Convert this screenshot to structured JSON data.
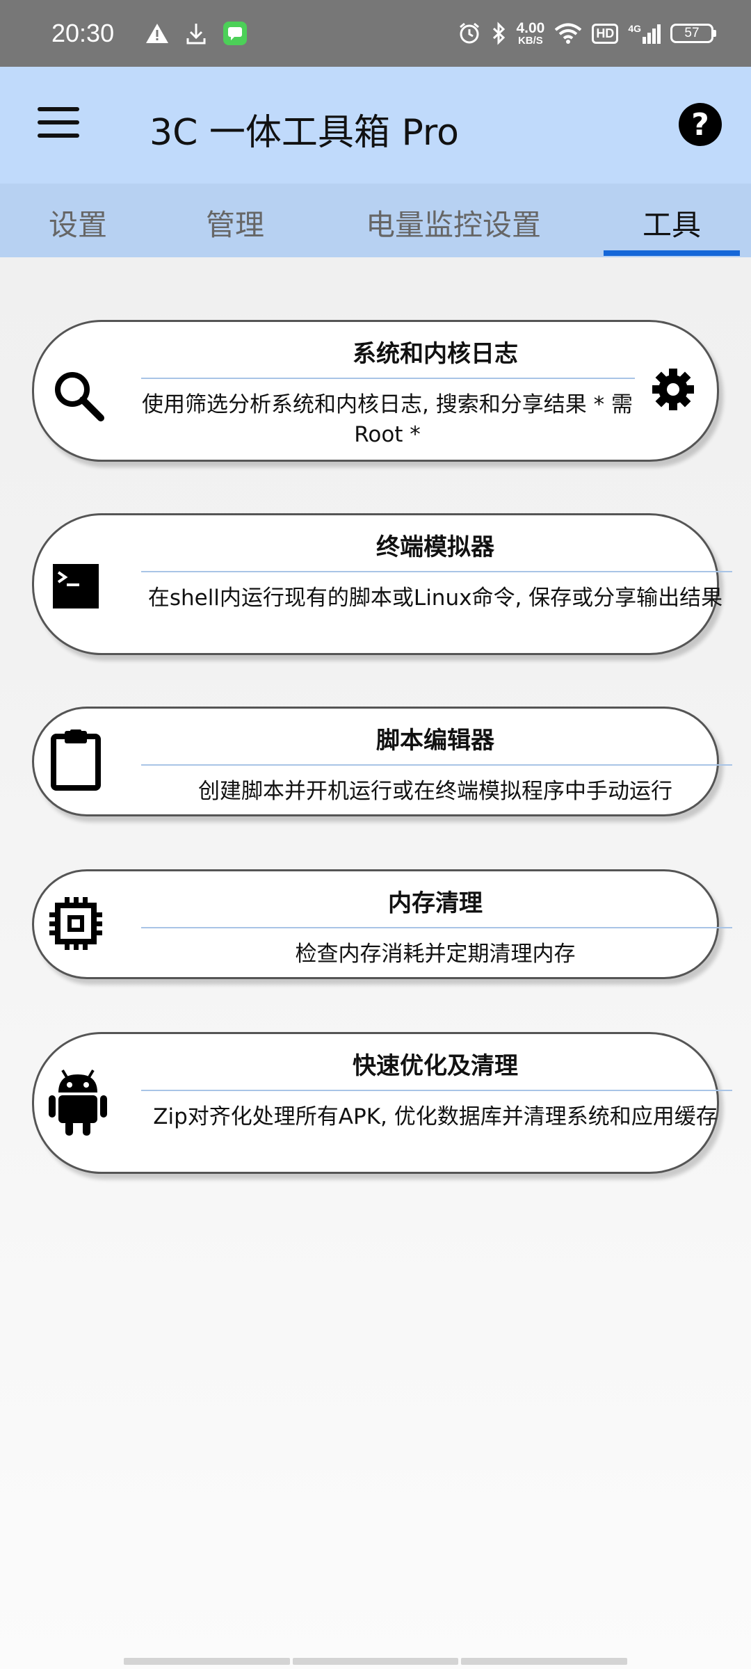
{
  "status_bar": {
    "time": "20:30",
    "left_icons": [
      "warning-icon",
      "download-icon",
      "messages-app-icon"
    ],
    "right_icons": [
      "alarm-icon",
      "bluetooth-icon",
      "wifi-icon",
      "signal-icon"
    ],
    "speed_value": "4.00",
    "speed_unit": "KB/S",
    "hd_label": "HD",
    "network_label": "4G",
    "battery": "57"
  },
  "app_bar": {
    "title": "3C 一体工具箱 Pro",
    "menu_icon": "hamburger-menu-icon",
    "help_icon": "help-icon",
    "help_glyph": "?",
    "background": "#c0dafb"
  },
  "tabs": {
    "items": [
      {
        "label": "设置"
      },
      {
        "label": "管理"
      },
      {
        "label": "电量监控设置"
      },
      {
        "label": "工具"
      }
    ],
    "active_index": 3,
    "indicator_color": "#1567d8"
  },
  "tools": [
    {
      "icon": "search-icon",
      "title": "系统和内核日志",
      "description": "使用筛选分析系统和内核日志, 搜索和分享结果 * 需Root *",
      "action_icon": "gear-icon"
    },
    {
      "icon": "terminal-icon",
      "title": "终端模拟器",
      "description": "在shell内运行现有的脚本或Linux命令, 保存或分享输出结果"
    },
    {
      "icon": "clipboard-icon",
      "title": "脚本编辑器",
      "description": "创建脚本并开机运行或在终端模拟程序中手动运行"
    },
    {
      "icon": "chip-icon",
      "title": "内存清理",
      "description": "检查内存消耗并定期清理内存"
    },
    {
      "icon": "android-icon",
      "title": "快速优化及清理",
      "description": "Zip对齐化处理所有APK, 优化数据库并清理系统和应用缓存"
    }
  ]
}
